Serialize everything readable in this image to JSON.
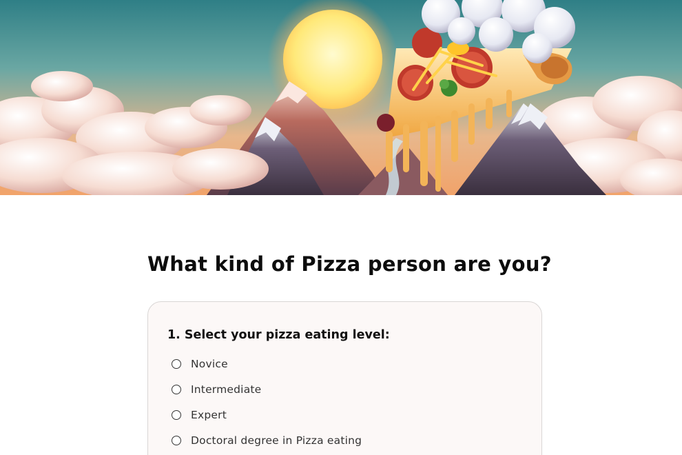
{
  "hero": {
    "image_name": "pizza-mountain-hero-image"
  },
  "page": {
    "title": "What kind of Pizza person are you?"
  },
  "quiz": {
    "question_1": {
      "label": "1. Select your pizza eating level:",
      "options": [
        "Novice",
        "Intermediate",
        "Expert",
        "Doctoral degree in Pizza eating"
      ],
      "selected": null
    }
  },
  "colors": {
    "background": "#ffffff",
    "card_background": "#fcf8f7",
    "card_border": "#d9d6d5",
    "text": "#111111",
    "option_text": "#333333"
  }
}
